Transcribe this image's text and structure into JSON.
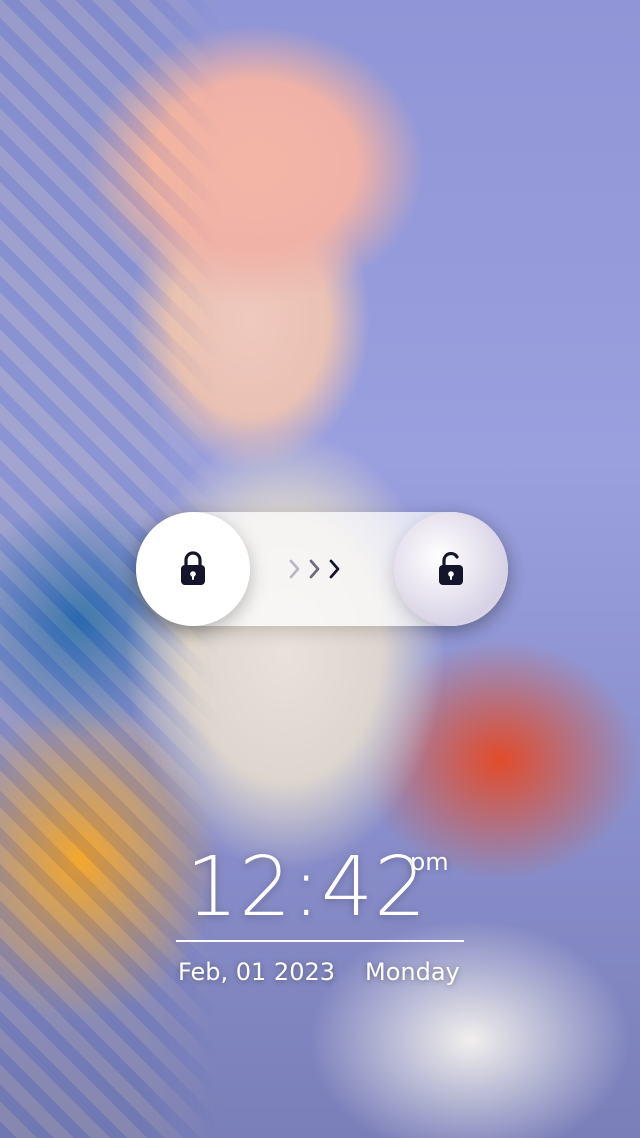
{
  "lock_screen": {
    "time": "12:42",
    "ampm": "pm",
    "date": "Feb, 01 2023",
    "weekday": "Monday"
  },
  "unlock_slider": {
    "lock_icon": "lock-icon",
    "unlock_icon": "unlock-icon",
    "arrow_icon": "chevron-right-icon"
  },
  "colors": {
    "text": "#ffffff",
    "icon": "#14142a"
  }
}
